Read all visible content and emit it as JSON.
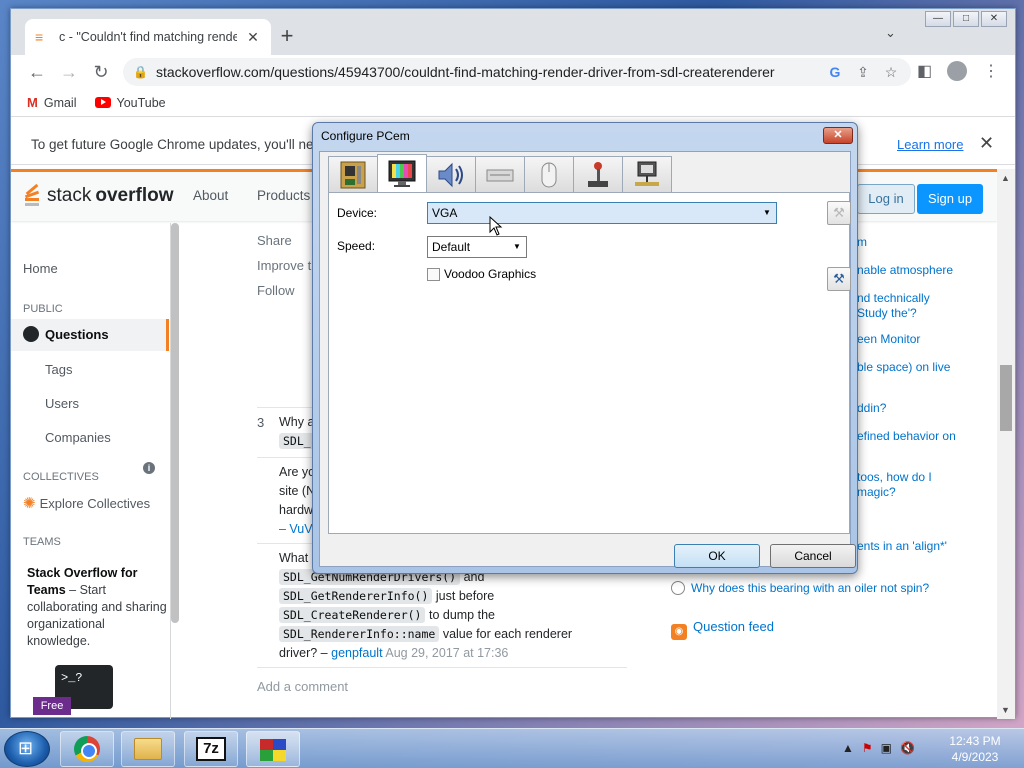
{
  "browser": {
    "tab_title": "c - \"Couldn't find matching rende",
    "tab_close": "✕",
    "new_tab": "+",
    "url": "stackoverflow.com/questions/45943700/couldnt-find-matching-render-driver-from-sdl-createrenderer",
    "bookmarks": [
      {
        "label": "Gmail"
      },
      {
        "label": "YouTube"
      }
    ],
    "infobar_text": "To get future Google Chrome updates, you'll nee",
    "infobar_link": "Learn more"
  },
  "so": {
    "logo_light": "stack",
    "logo_bold": "overflow",
    "nav": [
      "About",
      "Products"
    ],
    "login": "Log in",
    "signup": "Sign up",
    "leftnav": {
      "home": "Home",
      "public": "PUBLIC",
      "questions": "Questions",
      "tags": "Tags",
      "users": "Users",
      "companies": "Companies",
      "collectives": "COLLECTIVES",
      "explore_collectives": "Explore Collectives",
      "teams": "TEAMS",
      "teams_title": "Stack Overflow for Teams",
      "teams_desc": " – Start collaborating and sharing organizational knowledge.",
      "terminal": ">_?",
      "free": "Free"
    },
    "post_links": [
      "Share",
      "Improve th",
      "Follow"
    ],
    "vote_count": "3",
    "comments": {
      "c1_start": "Why a",
      "c1_code": "SDL_",
      "c2_lines": [
        "Are yo",
        "site (N",
        "hardw"
      ],
      "c2_user": "– VuV",
      "c3_prefix": "What",
      "c3_code1": "SDL_GetNumRenderDrivers()",
      "c3_and": "and",
      "c3_code2": "SDL_GetRendererInfo()",
      "c3_before": "just before",
      "c3_code3": "SDL_CreateRenderer()",
      "c3_dump": "to dump the",
      "c3_code4": "SDL_RendererInfo::name",
      "c3_value": "value for each renderer",
      "c3_driver": "driver? –",
      "c3_user": "genpfault",
      "c3_date": "Aug 29, 2017 at 17:36"
    },
    "add_comment": "Add a comment",
    "hot_questions": [
      "m",
      "nable atmosphere",
      "nd technically",
      "Study the'?",
      "een Monitor",
      "ble space) on live",
      "ddin?",
      "efined behavior on",
      "toos, how do I",
      "magic?",
      "ents in an 'align*'",
      "Why does this bearing with an oiler not spin?"
    ],
    "question_feed": "Question feed"
  },
  "dialog": {
    "title": "Configure PCem",
    "close": "✕",
    "tabs": [
      "motherboard",
      "display",
      "sound",
      "storage",
      "mouse",
      "joystick",
      "network"
    ],
    "selected_tab": "display",
    "device_label": "Device:",
    "device_value": "VGA",
    "speed_label": "Speed:",
    "speed_value": "Default",
    "voodoo_label": "Voodoo Graphics",
    "voodoo_checked": false,
    "ok": "OK",
    "cancel": "Cancel"
  },
  "taskbar": {
    "time": "12:43 PM",
    "date": "4/9/2023",
    "sevenz": "7z",
    "tray_arrow": "▲"
  }
}
